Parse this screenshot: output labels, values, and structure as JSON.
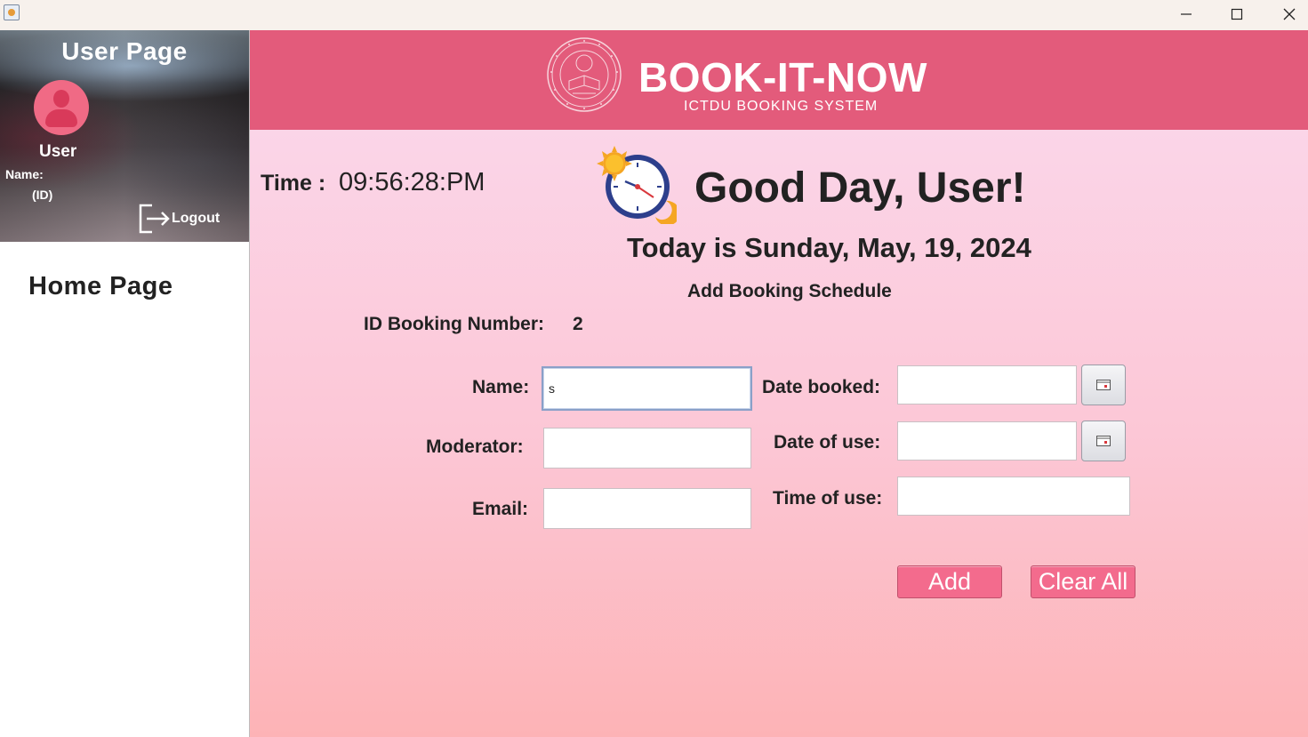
{
  "window": {
    "minimize_glyph": "—",
    "maximize_glyph": "☐",
    "close_glyph": "✕"
  },
  "sidebar": {
    "title": "User Page",
    "user_label": "User",
    "name_label": "Name:",
    "id_label": "(ID)",
    "logout_label": "Logout",
    "nav_title": "Home Page"
  },
  "banner": {
    "title": "BOOK-IT-NOW",
    "subtitle": "ICTDU BOOKING SYSTEM"
  },
  "main": {
    "time_label": "Time :",
    "time_value": "09:56:28:PM",
    "greeting": "Good Day, User!",
    "today": "Today is  Sunday, May, 19, 2024",
    "section_title": "Add Booking Schedule",
    "booking_id_label": "ID Booking Number:",
    "booking_id_value": "2"
  },
  "form": {
    "name_label": "Name:",
    "name_value": "s",
    "moderator_label": "Moderator:",
    "moderator_value": "",
    "email_label": "Email:",
    "email_value": "",
    "date_booked_label": "Date booked:",
    "date_booked_value": "",
    "date_of_use_label": "Date of use:",
    "date_of_use_value": "",
    "time_of_use_label": "Time of use:",
    "time_of_use_value": "",
    "add_label": "Add",
    "clear_label": "Clear All"
  },
  "colors": {
    "banner": "#e35b7b",
    "button": "#f36b8d",
    "avatar": "#f06a85"
  }
}
